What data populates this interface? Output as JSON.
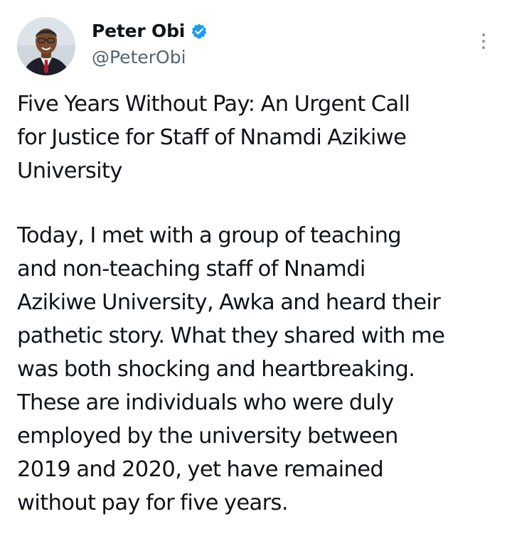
{
  "tweet": {
    "author": {
      "display_name": "Peter Obi",
      "handle": "@PeterObi",
      "verified": true,
      "verified_color": "#1d9bf0"
    },
    "menu_icon": "more-vertical-icon",
    "title": "Five Years Without Pay: An Urgent Call\nfor Justice for Staff of Nnamdi Azikiwe\nUniversity",
    "body": "Today, I met with a group of teaching\nand non-teaching staff of Nnamdi\nAzikiwe University, Awka and heard their\npathetic story. What they shared with me\nwas both shocking and heartbreaking.\nThese are individuals who were duly\nemployed by the university between\n2019 and 2020, yet have remained\nwithout pay for five years."
  }
}
